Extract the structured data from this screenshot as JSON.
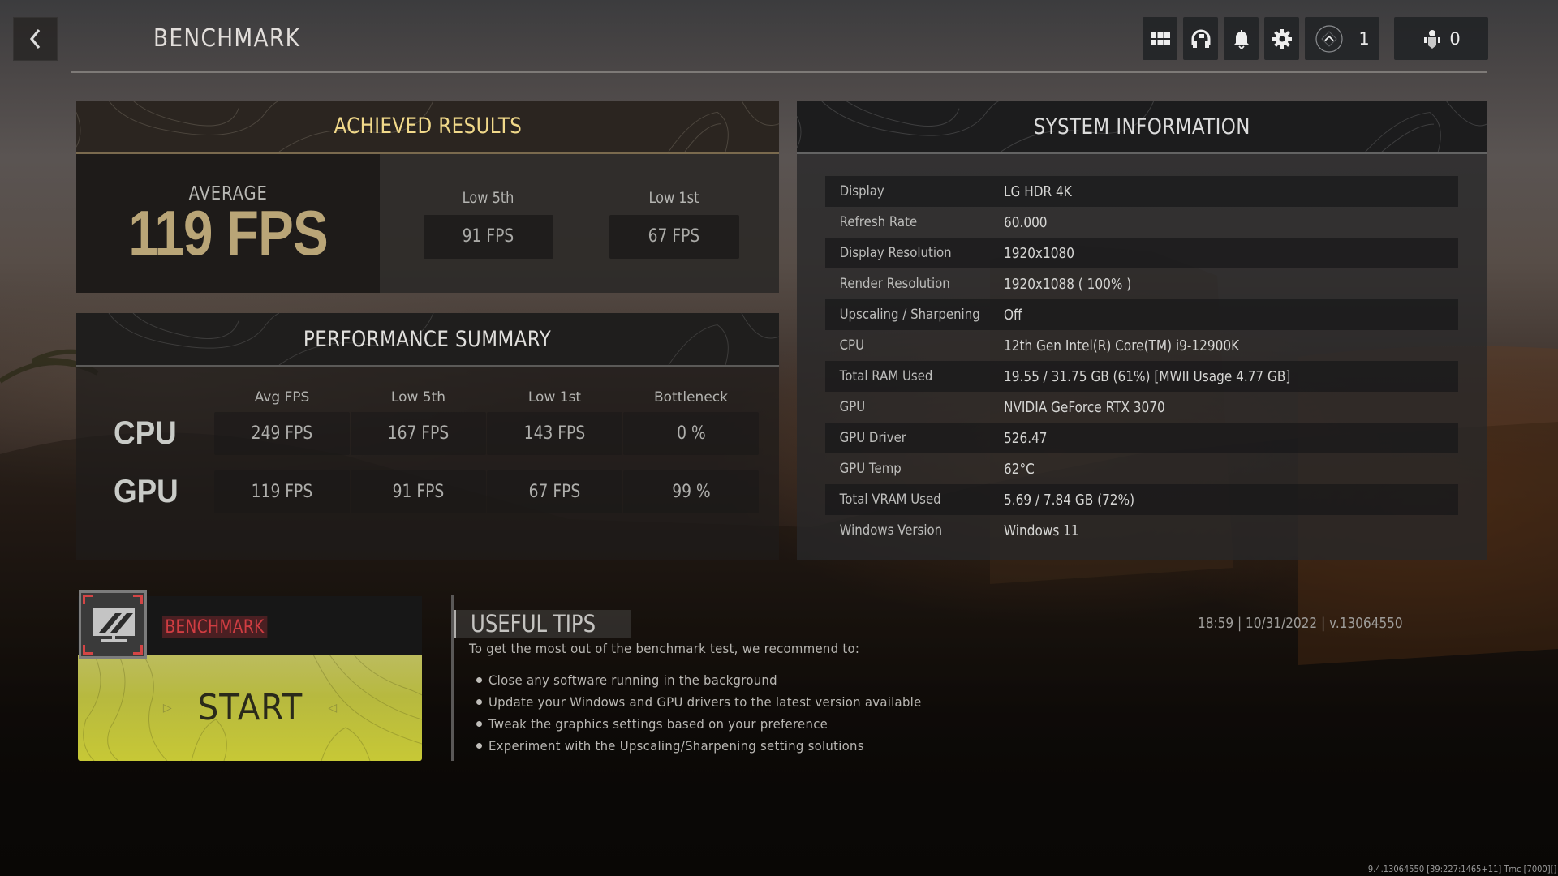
{
  "header": {
    "title": "BENCHMARK",
    "back_icon": "chevron-left-icon",
    "icons": [
      "grid-menu-icon",
      "headset-icon",
      "bell-icon",
      "gear-icon"
    ],
    "rank_icon": "rank-chevron-icon",
    "rank_count": "1",
    "party_icon": "party-members-icon",
    "party_count": "0"
  },
  "achieved": {
    "title": "ACHIEVED RESULTS",
    "average_label": "AVERAGE",
    "average_value": "119 FPS",
    "lows": [
      {
        "label": "Low 5th",
        "value": "91 FPS"
      },
      {
        "label": "Low 1st",
        "value": "67 FPS"
      }
    ]
  },
  "performance": {
    "title": "PERFORMANCE SUMMARY",
    "columns": [
      "Avg FPS",
      "Low 5th",
      "Low 1st",
      "Bottleneck"
    ],
    "rows": [
      {
        "label": "CPU",
        "values": [
          "249 FPS",
          "167 FPS",
          "143 FPS",
          "0 %"
        ]
      },
      {
        "label": "GPU",
        "values": [
          "119 FPS",
          "91 FPS",
          "67 FPS",
          "99 %"
        ]
      }
    ]
  },
  "system": {
    "title": "SYSTEM INFORMATION",
    "rows": [
      {
        "key": "Display",
        "value": "LG HDR 4K"
      },
      {
        "key": "Refresh Rate",
        "value": "60.000"
      },
      {
        "key": "Display Resolution",
        "value": "1920x1080"
      },
      {
        "key": "Render Resolution",
        "value": "1920x1088 ( 100% )"
      },
      {
        "key": "Upscaling / Sharpening",
        "value": "Off"
      },
      {
        "key": "CPU",
        "value": "12th Gen Intel(R) Core(TM) i9-12900K"
      },
      {
        "key": "Total RAM Used",
        "value": "19.55 / 31.75 GB (61%) [MWII Usage 4.77 GB]"
      },
      {
        "key": "GPU",
        "value": "NVIDIA GeForce RTX 3070"
      },
      {
        "key": "GPU Driver",
        "value": "526.47"
      },
      {
        "key": "GPU Temp",
        "value": "62°C"
      },
      {
        "key": "Total VRAM Used",
        "value": "5.69 / 7.84 GB (72%)"
      },
      {
        "key": "Windows Version",
        "value": "Windows 11"
      }
    ]
  },
  "mode": {
    "icon": "monitor-benchmark-icon",
    "label": "BENCHMARK",
    "start_label": "START",
    "label_color": "#d03d42",
    "start_color": "#c2c33c"
  },
  "tips": {
    "title": "USEFUL TIPS",
    "intro": "To get the most out of the benchmark test, we recommend to:",
    "items": [
      "Close any software running in the background",
      "Update your Windows and GPU drivers to the latest version available",
      "Tweak the graphics settings based on your preference",
      "Experiment with the Upscaling/Sharpening setting solutions"
    ]
  },
  "meta": {
    "time": "18:59",
    "date": "10/31/2022",
    "version": "v.13064550",
    "line": "18:59 | 10/31/2022 | v.13064550",
    "build_string": "9.4.13064550 [39:227:1465+11] Tmc [7000][]"
  },
  "colors": {
    "achieved_title": "#f1d98a",
    "average_value": "#b9a577",
    "start_button": "#c2c33c",
    "benchmark_tag": "#d03d42"
  }
}
